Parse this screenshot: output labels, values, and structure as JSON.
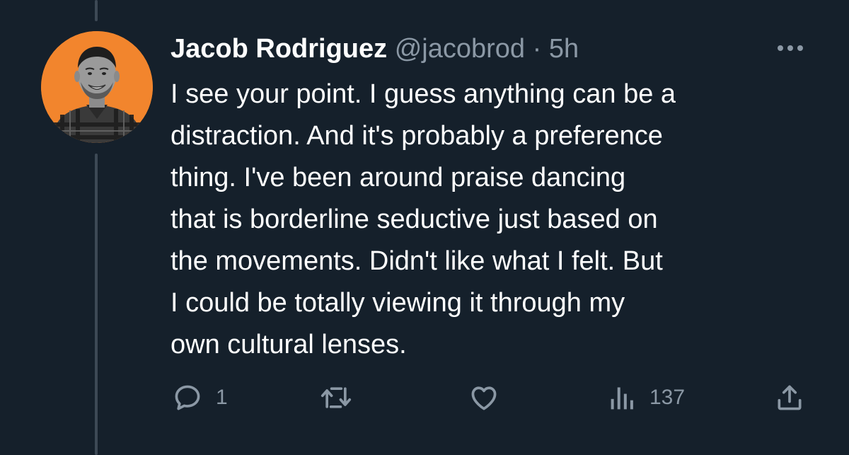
{
  "tweet": {
    "author": {
      "display_name": "Jacob Rodriguez",
      "handle": "@jacobrod",
      "avatar_icon": "profile-photo"
    },
    "separator": "·",
    "timestamp": "5h",
    "text_lines": [
      "I see your point. I guess anything can be a",
      "distraction. And it's probably a preference",
      "thing. I've been around praise dancing",
      "that is borderline seductive just based on",
      "the movements. Didn't like what I felt. But",
      "I could be totally viewing it through my",
      "own cultural lenses."
    ],
    "actions": {
      "reply": {
        "icon": "reply-icon",
        "count": "1"
      },
      "retweet": {
        "icon": "retweet-icon",
        "count": ""
      },
      "like": {
        "icon": "heart-icon",
        "count": ""
      },
      "views": {
        "icon": "analytics-icon",
        "count": "137"
      },
      "share": {
        "icon": "share-icon",
        "count": ""
      }
    }
  },
  "colors": {
    "background": "#15202b",
    "primary_text": "#ffffff",
    "secondary_text": "#8b98a5",
    "thread_line": "#3d4955",
    "avatar_bg": "#f2852d"
  }
}
